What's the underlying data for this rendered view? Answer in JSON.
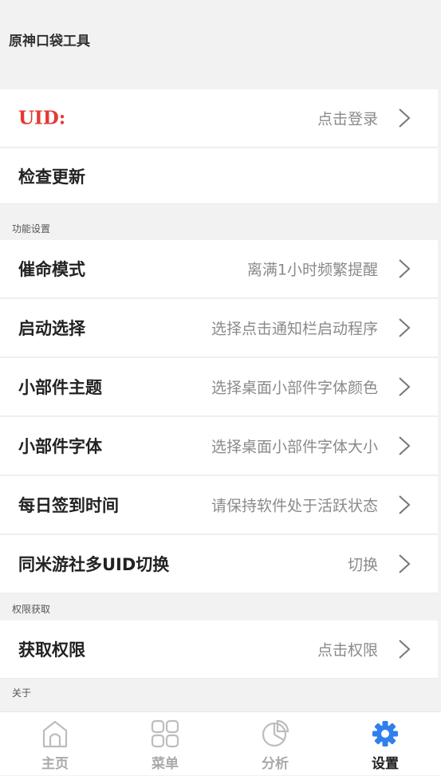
{
  "header": {
    "title": "原神口袋工具"
  },
  "account": [
    {
      "label": "UID:",
      "value": "点击登录",
      "chevron": true
    },
    {
      "label": "检查更新",
      "value": "",
      "chevron": false
    }
  ],
  "sections": {
    "function_settings": "功能设置",
    "permissions": "权限获取",
    "about": "关于"
  },
  "function_items": [
    {
      "label": "催命模式",
      "value": "离满1小时频繁提醒"
    },
    {
      "label": "启动选择",
      "value": "选择点击通知栏启动程序"
    },
    {
      "label": "小部件主题",
      "value": "选择桌面小部件字体颜色"
    },
    {
      "label": "小部件字体",
      "value": "选择桌面小部件字体大小"
    },
    {
      "label": "每日签到时间",
      "value": "请保持软件处于活跃状态"
    },
    {
      "label": "同米游社多UID切换",
      "value": "切换"
    }
  ],
  "permission_items": [
    {
      "label": "获取权限",
      "value": "点击权限"
    }
  ],
  "tabbar": {
    "items": [
      {
        "label": "主页",
        "icon": "home-icon"
      },
      {
        "label": "菜单",
        "icon": "grid-icon"
      },
      {
        "label": "分析",
        "icon": "pie-chart-icon"
      },
      {
        "label": "设置",
        "icon": "gear-icon"
      }
    ],
    "active": "设置",
    "active_color": "#2f80ed",
    "inactive_color": "#a9a9a9"
  },
  "colors": {
    "uid_label": "#e53935",
    "background": "#f2f2f2"
  }
}
